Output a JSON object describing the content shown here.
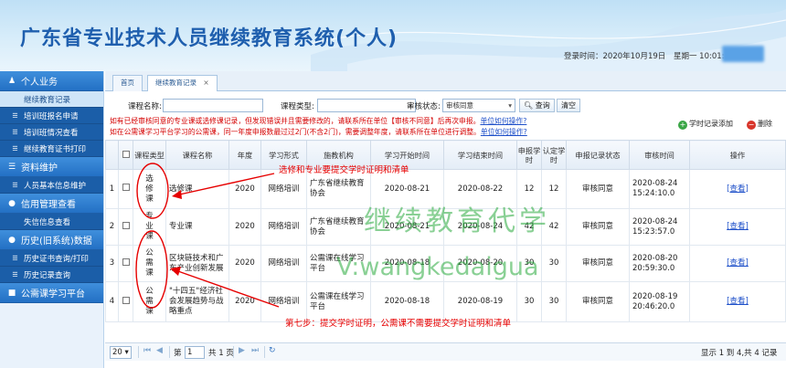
{
  "header": {
    "title": "广东省专业技术人员继续教育系统(个人)",
    "login_time_label": "登录时间：2020年10月19日",
    "login_weekday_time": "星期一 10:01:12"
  },
  "sidebar": {
    "groups": [
      {
        "label": "个人业务",
        "icon": "user-icon",
        "items": [
          "继续教育记录",
          "培训班报名申请",
          "培训班情况查看",
          "继续教育证书打印"
        ]
      },
      {
        "label": "资料维护",
        "icon": "list-icon",
        "items": [
          "人员基本信息维护"
        ]
      },
      {
        "label": "信用管理查看",
        "icon": "pin-icon",
        "items": [
          "失信信息查看"
        ]
      },
      {
        "label": "历史(旧系统)数据",
        "icon": "pin-icon",
        "items": [
          "历史证书查询/打印",
          "历史记录查询"
        ]
      },
      {
        "label": "公需课学习平台",
        "icon": "square-icon",
        "items": []
      }
    ],
    "active_item": "继续教育记录"
  },
  "tabs": [
    {
      "label": "首页"
    },
    {
      "label": "继续教育记录",
      "close": "×"
    }
  ],
  "filters": {
    "course_name_label": "课程名称:",
    "course_name_value": "",
    "course_type_label": "课程类型:",
    "course_type_value": "",
    "audit_status_label": "审核状态:",
    "audit_status_value": "审核同意",
    "search_btn": "查询",
    "clear_btn": "清空"
  },
  "notices": [
    {
      "text": "如有已经审核同意的专业课或选修课记录，但发现错误并且需要修改的，请联系所在单位【审核不同意】后再次申报。",
      "link": "单位如何操作?"
    },
    {
      "text": "如在公需课学习平台学习的公需课，同一年度申报数最过过2门(不含2门)，需要调整年度，请联系所在单位进行调整。",
      "link": "单位如何操作?"
    }
  ],
  "actions": {
    "add_btn": "学时记录添加",
    "delete_btn": "删除"
  },
  "table": {
    "columns": [
      "",
      "课程类型",
      "课程名称",
      "年度",
      "学习形式",
      "施教机构",
      "学习开始时间",
      "学习结束时间",
      "申报学时",
      "认定学时",
      "申报记录状态",
      "审核时间",
      "操作"
    ],
    "rows": [
      {
        "no": "1",
        "type": "选修课",
        "name": "选修课",
        "year": "2020",
        "form": "网络培训",
        "org": "广东省继续教育协会",
        "start": "2020-08-21",
        "end": "2020-08-22",
        "apply": "12",
        "approved": "12",
        "status": "审核同意",
        "audit_date": "2020-08-24",
        "audit_time": "15:24:10.0",
        "op": "[查看]"
      },
      {
        "no": "2",
        "type": "专业课",
        "name": "专业课",
        "year": "2020",
        "form": "网络培训",
        "org": "广东省继续教育协会",
        "start": "2020-08-21",
        "end": "2020-08-24",
        "apply": "42",
        "approved": "42",
        "status": "审核同意",
        "audit_date": "2020-08-24",
        "audit_time": "15:23:57.0",
        "op": "[查看]"
      },
      {
        "no": "3",
        "type": "公需课",
        "name": "区块链技术和广东产业创新发展",
        "year": "2020",
        "form": "网络培训",
        "org": "公需课在线学习平台",
        "start": "2020-08-18",
        "end": "2020-08-20",
        "apply": "30",
        "approved": "30",
        "status": "审核同意",
        "audit_date": "2020-08-20",
        "audit_time": "20:59:30.0",
        "op": "[查看]"
      },
      {
        "no": "4",
        "type": "公需课",
        "name": "\"十四五\"经济社会发展趋势与战略重点",
        "year": "2020",
        "form": "网络培训",
        "org": "公需课在线学习平台",
        "start": "2020-08-18",
        "end": "2020-08-19",
        "apply": "30",
        "approved": "30",
        "status": "审核同意",
        "audit_date": "2020-08-19",
        "audit_time": "20:46:20.0",
        "op": "[查看]"
      }
    ]
  },
  "pager": {
    "page_size": "20",
    "page_prefix": "第",
    "page_no": "1",
    "page_suffix": "共 1 页",
    "summary": "显示 1 到 4,共 4 记录"
  },
  "annotations": {
    "top_note": "选修和专业要提交学时证明和清单",
    "bottom_note": "第七步：提交学时证明，公需课不需要提交学时证明和清单",
    "watermark_line1": "继续教育代学",
    "watermark_line2": "V:wangkedaigua"
  },
  "colors": {
    "accent": "#2370c4",
    "annotation_red": "#e60000",
    "watermark_green": "#28aa3c",
    "link_blue": "#1d4fc9"
  }
}
